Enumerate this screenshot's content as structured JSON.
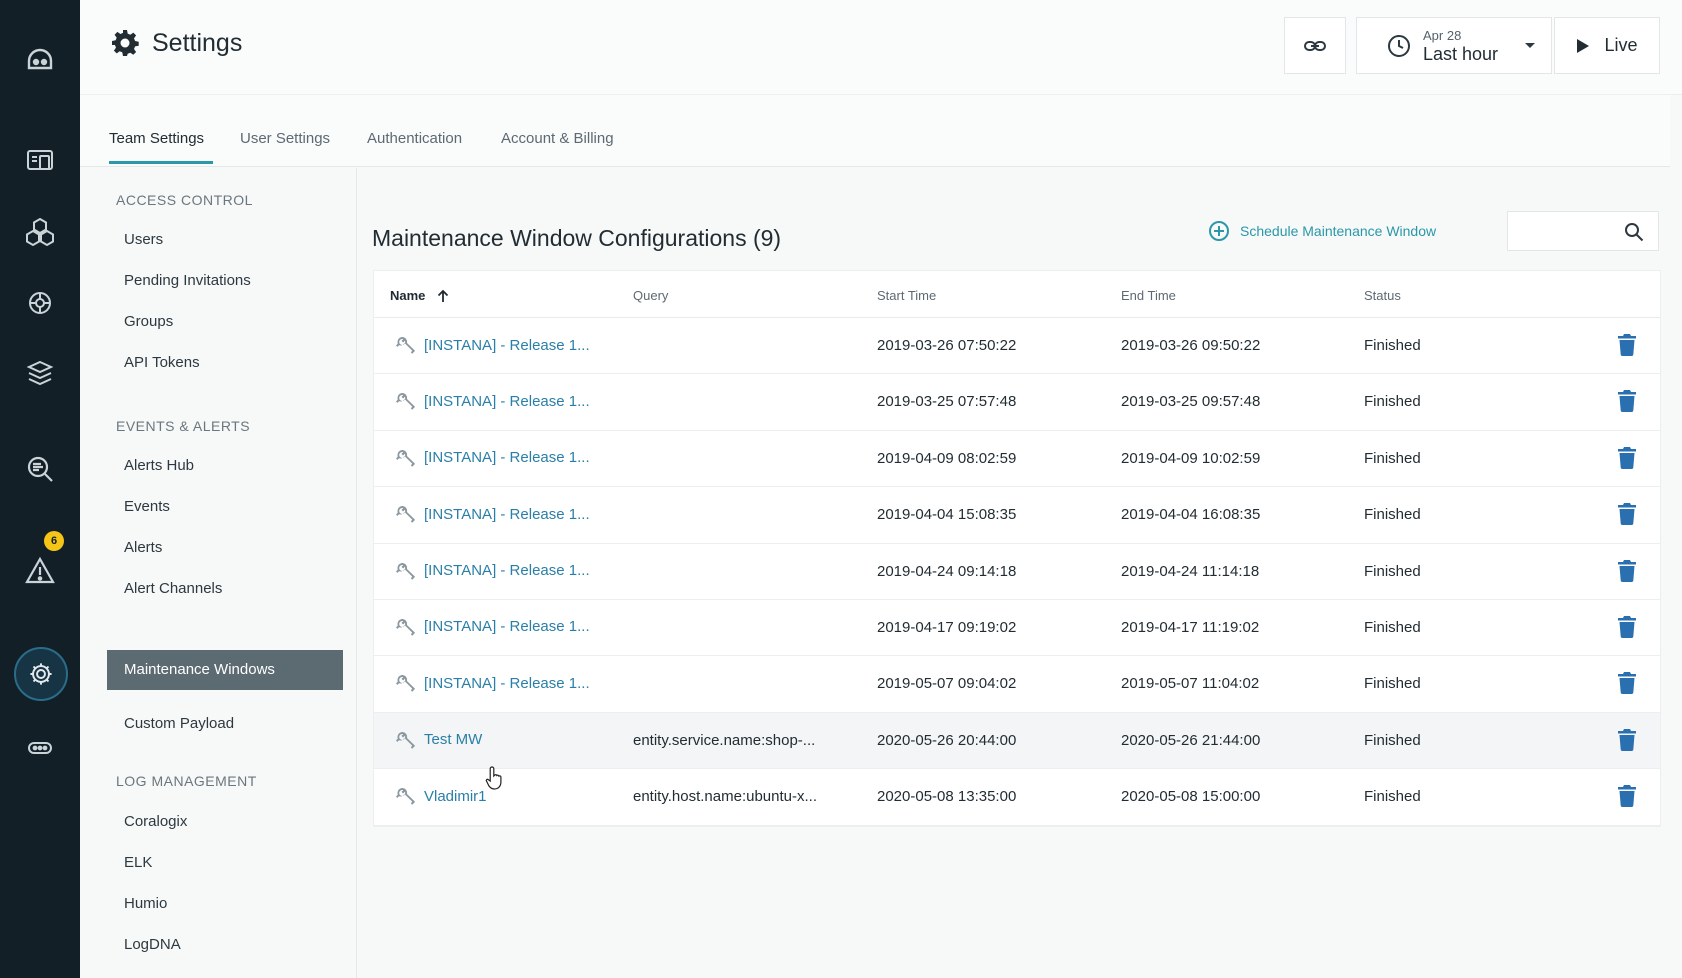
{
  "header": {
    "title": "Settings",
    "time_date": "Apr 28",
    "time_range": "Last hour",
    "live_label": "Live"
  },
  "tabs": [
    {
      "label": "Team Settings",
      "active": true
    },
    {
      "label": "User Settings",
      "active": false
    },
    {
      "label": "Authentication",
      "active": false
    },
    {
      "label": "Account & Billing",
      "active": false
    }
  ],
  "nav": {
    "access_control": {
      "heading": "ACCESS CONTROL",
      "items": [
        "Users",
        "Pending Invitations",
        "Groups",
        "API Tokens"
      ]
    },
    "events_alerts": {
      "heading": "EVENTS & ALERTS",
      "items": [
        "Alerts Hub",
        "Events",
        "Alerts",
        "Alert Channels",
        "Maintenance Windows",
        "Custom Payload"
      ]
    },
    "log_management": {
      "heading": "LOG MANAGEMENT",
      "items": [
        "Coralogix",
        "ELK",
        "Humio",
        "LogDNA"
      ]
    },
    "active_item": "Maintenance Windows"
  },
  "rail": {
    "alert_badge": "6"
  },
  "main": {
    "title": "Maintenance Window Configurations (9)",
    "schedule_label": "Schedule Maintenance Window",
    "search_placeholder": "",
    "columns": {
      "name": "Name",
      "query": "Query",
      "start": "Start Time",
      "end": "End Time",
      "status": "Status"
    },
    "rows": [
      {
        "name": "[INSTANA] - Release 1...",
        "query": "",
        "start": "2019-03-26 07:50:22",
        "end": "2019-03-26 09:50:22",
        "status": "Finished"
      },
      {
        "name": "[INSTANA] - Release 1...",
        "query": "",
        "start": "2019-03-25 07:57:48",
        "end": "2019-03-25 09:57:48",
        "status": "Finished"
      },
      {
        "name": "[INSTANA] - Release 1...",
        "query": "",
        "start": "2019-04-09 08:02:59",
        "end": "2019-04-09 10:02:59",
        "status": "Finished"
      },
      {
        "name": "[INSTANA] - Release 1...",
        "query": "",
        "start": "2019-04-04 15:08:35",
        "end": "2019-04-04 16:08:35",
        "status": "Finished"
      },
      {
        "name": "[INSTANA] - Release 1...",
        "query": "",
        "start": "2019-04-24 09:14:18",
        "end": "2019-04-24 11:14:18",
        "status": "Finished"
      },
      {
        "name": "[INSTANA] - Release 1...",
        "query": "",
        "start": "2019-04-17 09:19:02",
        "end": "2019-04-17 11:19:02",
        "status": "Finished"
      },
      {
        "name": "[INSTANA] - Release 1...",
        "query": "",
        "start": "2019-05-07 09:04:02",
        "end": "2019-05-07 11:04:02",
        "status": "Finished"
      },
      {
        "name": "Test MW",
        "query": "entity.service.name:shop-...",
        "start": "2020-05-26 20:44:00",
        "end": "2020-05-26 21:44:00",
        "status": "Finished"
      },
      {
        "name": "Vladimir1",
        "query": "entity.host.name:ubuntu-x...",
        "start": "2020-05-08 13:35:00",
        "end": "2020-05-08 15:00:00",
        "status": "Finished"
      }
    ]
  },
  "colors": {
    "rail": "#121f26",
    "accent": "#2a98a8",
    "link": "#2a7fa8",
    "delete": "#2a6fb0",
    "nav_active": "#5c6a72"
  }
}
